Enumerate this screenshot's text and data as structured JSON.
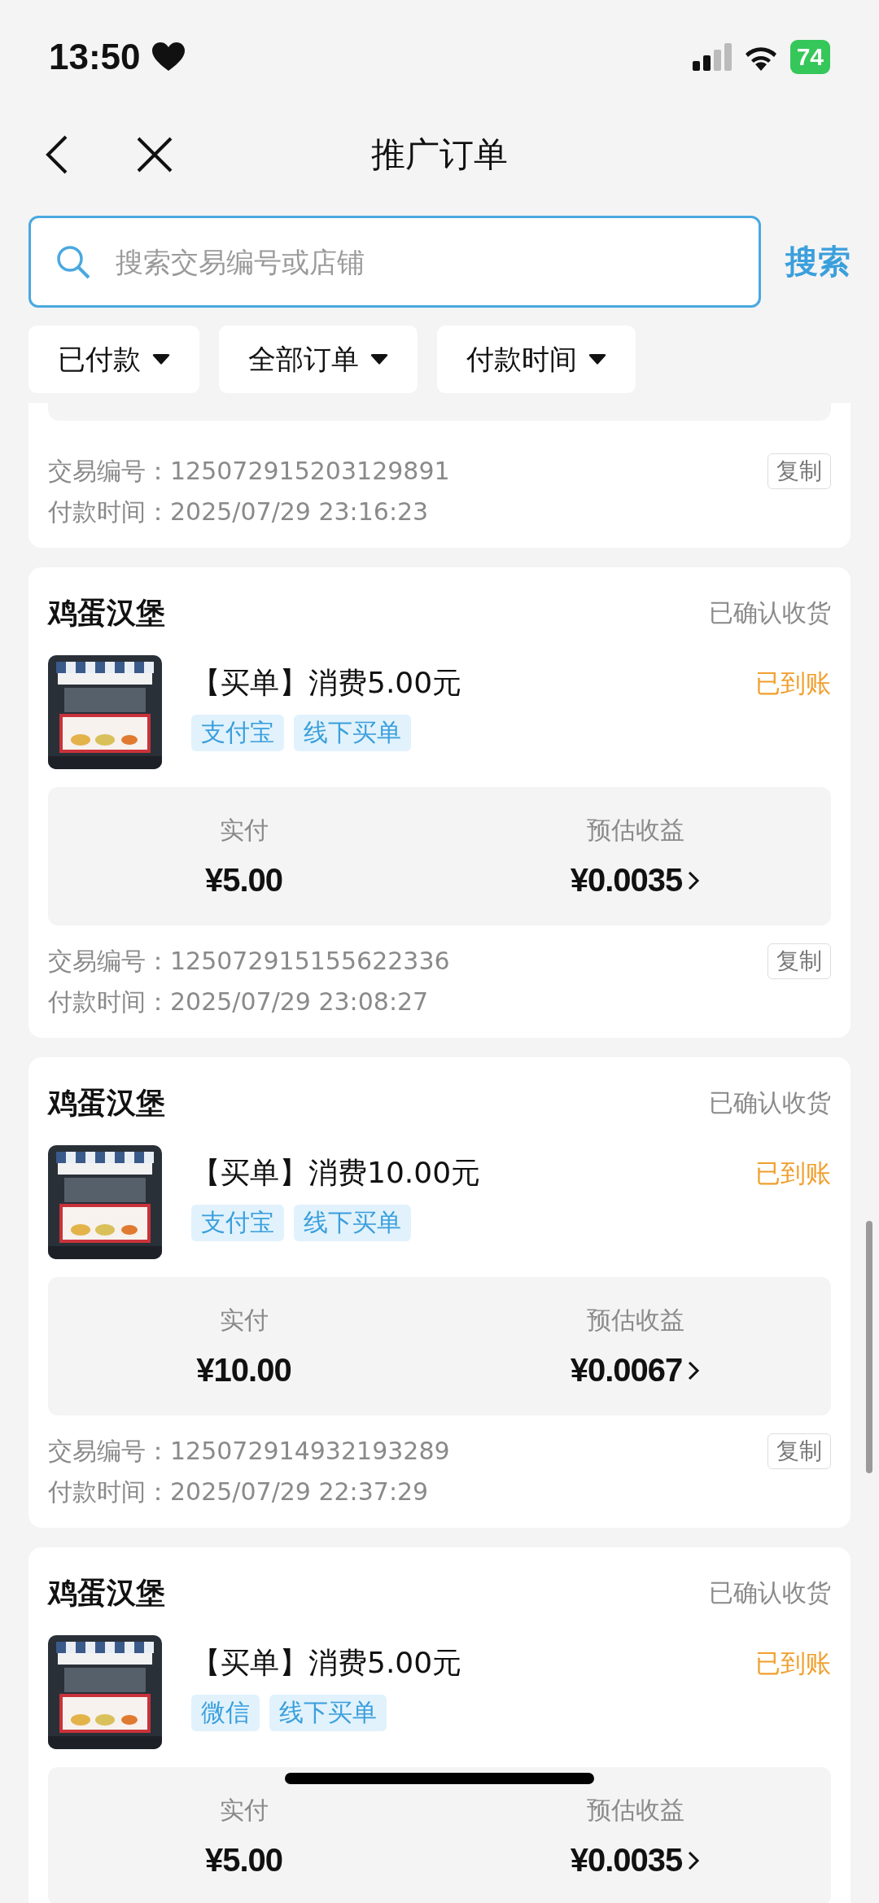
{
  "status_bar": {
    "time": "13:50",
    "battery": "74"
  },
  "nav": {
    "title": "推广订单"
  },
  "search": {
    "placeholder": "搜索交易编号或店铺",
    "button": "搜索"
  },
  "filters": [
    {
      "label": "已付款"
    },
    {
      "label": "全部订单"
    },
    {
      "label": "付款时间"
    }
  ],
  "orders": [
    {
      "kind": "partial",
      "trade_no_label": "交易编号：",
      "trade_no": "125072915203129891",
      "pay_time_label": "付款时间：",
      "pay_time": "2025/07/29 23:16:23",
      "copy": "复制"
    },
    {
      "kind": "full",
      "shop": "鸡蛋汉堡",
      "order_status": "已确认收货",
      "title": "【买单】消费5.00元",
      "settle_status": "已到账",
      "tags": [
        "支付宝",
        "线下买单"
      ],
      "paid_label": "实付",
      "paid": "¥5.00",
      "income_label": "预估收益",
      "income": "¥0.0035",
      "trade_no_label": "交易编号：",
      "trade_no": "125072915155622336",
      "pay_time_label": "付款时间：",
      "pay_time": "2025/07/29 23:08:27",
      "copy": "复制"
    },
    {
      "kind": "full",
      "shop": "鸡蛋汉堡",
      "order_status": "已确认收货",
      "title": "【买单】消费10.00元",
      "settle_status": "已到账",
      "tags": [
        "支付宝",
        "线下买单"
      ],
      "paid_label": "实付",
      "paid": "¥10.00",
      "income_label": "预估收益",
      "income": "¥0.0067",
      "trade_no_label": "交易编号：",
      "trade_no": "125072914932193289",
      "pay_time_label": "付款时间：",
      "pay_time": "2025/07/29 22:37:29",
      "copy": "复制"
    },
    {
      "kind": "full",
      "shop": "鸡蛋汉堡",
      "order_status": "已确认收货",
      "title": "【买单】消费5.00元",
      "settle_status": "已到账",
      "tags": [
        "微信",
        "线下买单"
      ],
      "paid_label": "实付",
      "paid": "¥5.00",
      "income_label": "预估收益",
      "income": "¥0.0035"
    }
  ]
}
